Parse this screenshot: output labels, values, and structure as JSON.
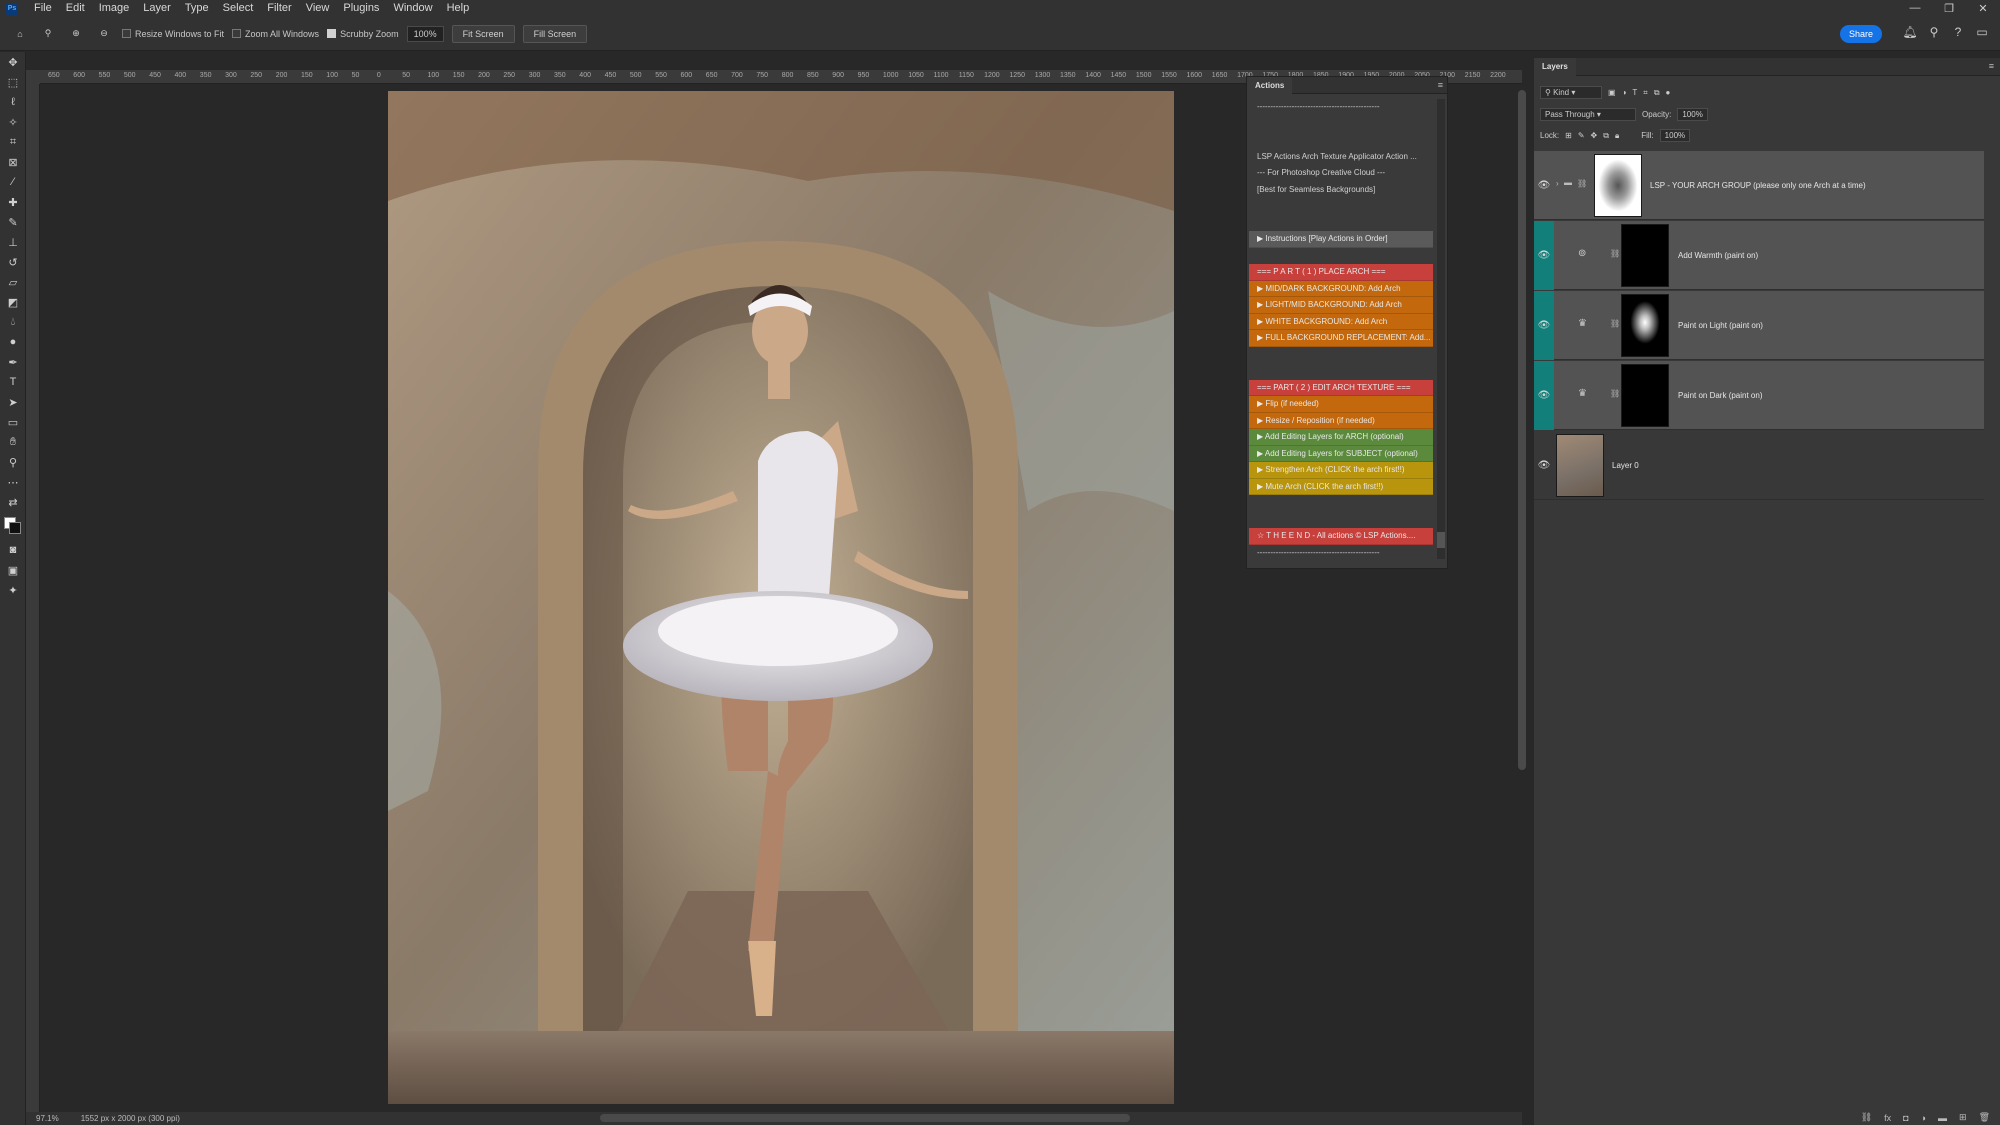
{
  "menubar": {
    "app_badge": "Ps",
    "items": [
      "File",
      "Edit",
      "Image",
      "Layer",
      "Type",
      "Select",
      "Filter",
      "View",
      "Plugins",
      "Window",
      "Help"
    ]
  },
  "options_bar": {
    "resize_windows": "Resize Windows to Fit",
    "zoom_all": "Zoom All Windows",
    "scrubby_zoom": "Scrubby Zoom",
    "zoom_value": "100%",
    "fit_screen": "Fit Screen",
    "fill_screen": "Fill Screen",
    "share": "Share"
  },
  "ruler_labels": [
    "650",
    "600",
    "550",
    "500",
    "450",
    "400",
    "350",
    "300",
    "250",
    "200",
    "150",
    "100",
    "50",
    "0",
    "50",
    "100",
    "150",
    "200",
    "250",
    "300",
    "350",
    "400",
    "450",
    "500",
    "550",
    "600",
    "650",
    "700",
    "750",
    "800",
    "850",
    "900",
    "950",
    "1000",
    "1050",
    "1100",
    "1150",
    "1200",
    "1250",
    "1300",
    "1350",
    "1400",
    "1450",
    "1500",
    "1550",
    "1600",
    "1650",
    "1700",
    "1750",
    "1800",
    "1850",
    "1900",
    "1950",
    "2000",
    "2050",
    "2100",
    "2150",
    "2200"
  ],
  "status_bar": {
    "zoom": "97.1%",
    "doc_info": "1552 px x 2000 px (300 ppi)"
  },
  "actions_panel": {
    "title": "Actions",
    "rows": [
      {
        "text": "----------------------------------------------",
        "style": "plain"
      },
      {
        "text": "",
        "style": "plain"
      },
      {
        "text": "",
        "style": "plain"
      },
      {
        "text": "LSP Actions Arch Texture Applicator Action ...",
        "style": "plain"
      },
      {
        "text": "--- For Photoshop Creative Cloud ---",
        "style": "plain"
      },
      {
        "text": "[Best for Seamless Backgrounds]",
        "style": "plain"
      },
      {
        "text": "",
        "style": "plain"
      },
      {
        "text": "",
        "style": "plain"
      },
      {
        "text": "▶ Instructions [Play Actions in Order]",
        "style": "gray"
      },
      {
        "text": "",
        "style": "plain"
      },
      {
        "text": "=== P A R T  ( 1 )  PLACE ARCH ===",
        "style": "red"
      },
      {
        "text": "▶ MID/DARK BACKGROUND: Add Arch",
        "style": "orange"
      },
      {
        "text": "▶ LIGHT/MID BACKGROUND: Add Arch",
        "style": "orange"
      },
      {
        "text": "▶ WHITE BACKGROUND: Add Arch",
        "style": "orange"
      },
      {
        "text": "▶ FULL BACKGROUND REPLACEMENT: Add...",
        "style": "orange"
      },
      {
        "text": "",
        "style": "plain"
      },
      {
        "text": "",
        "style": "plain"
      },
      {
        "text": "===  PART ( 2 )  EDIT ARCH TEXTURE ===",
        "style": "red"
      },
      {
        "text": "▶ Flip (if needed)",
        "style": "orange"
      },
      {
        "text": "▶ Resize / Reposition (if needed)",
        "style": "orange"
      },
      {
        "text": "▶ Add Editing Layers for ARCH (optional)",
        "style": "green"
      },
      {
        "text": "▶ Add Editing Layers for SUBJECT (optional)",
        "style": "green"
      },
      {
        "text": "▶ Strengthen Arch (CLICK the arch first!!)",
        "style": "gold"
      },
      {
        "text": "▶ Mute Arch (CLICK the arch first!!)",
        "style": "gold"
      },
      {
        "text": "",
        "style": "plain"
      },
      {
        "text": "",
        "style": "plain"
      },
      {
        "text": "☆ T H E  E N D - All actions © LSP Actions....",
        "style": "red"
      },
      {
        "text": "----------------------------------------------",
        "style": "plain"
      }
    ]
  },
  "layers_panel": {
    "title": "Layers",
    "kind_filter": "Kind",
    "blend_mode": "Pass Through",
    "opacity_label": "Opacity:",
    "opacity": "100%",
    "lock_label": "Lock:",
    "fill_label": "Fill:",
    "fill": "100%",
    "layers": [
      {
        "name": "LSP - YOUR ARCH GROUP (please only one Arch at a time)",
        "type": "group",
        "highlight": false
      },
      {
        "name": "Add Warmth (paint on)",
        "type": "adjustment",
        "highlight": true
      },
      {
        "name": "Paint on Light (paint on)",
        "type": "adjustment",
        "highlight": true
      },
      {
        "name": "Paint on Dark (paint on)",
        "type": "adjustment",
        "highlight": true
      },
      {
        "name": "Layer 0",
        "type": "pixel",
        "highlight": false
      }
    ]
  }
}
